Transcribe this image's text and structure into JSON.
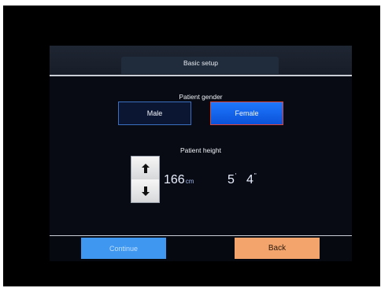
{
  "header": {
    "title": "Basic setup"
  },
  "gender": {
    "label": "Patient gender",
    "options": [
      {
        "label": "Male",
        "selected": false
      },
      {
        "label": "Female",
        "selected": true
      }
    ]
  },
  "height": {
    "label": "Patient height",
    "cm_value": "166",
    "cm_unit": "cm",
    "feet_value": "5",
    "feet_mark": "'",
    "inches_value": "4",
    "inches_mark": "\"",
    "up_icon": "arrow-up-icon",
    "down_icon": "arrow-down-icon"
  },
  "footer": {
    "continue_label": "Continue",
    "back_label": "Back"
  },
  "colors": {
    "selected_accent": "#1e78ff",
    "selected_border": "#e0453a",
    "continue_button": "#3f97f0",
    "back_button": "#f3a46c"
  }
}
